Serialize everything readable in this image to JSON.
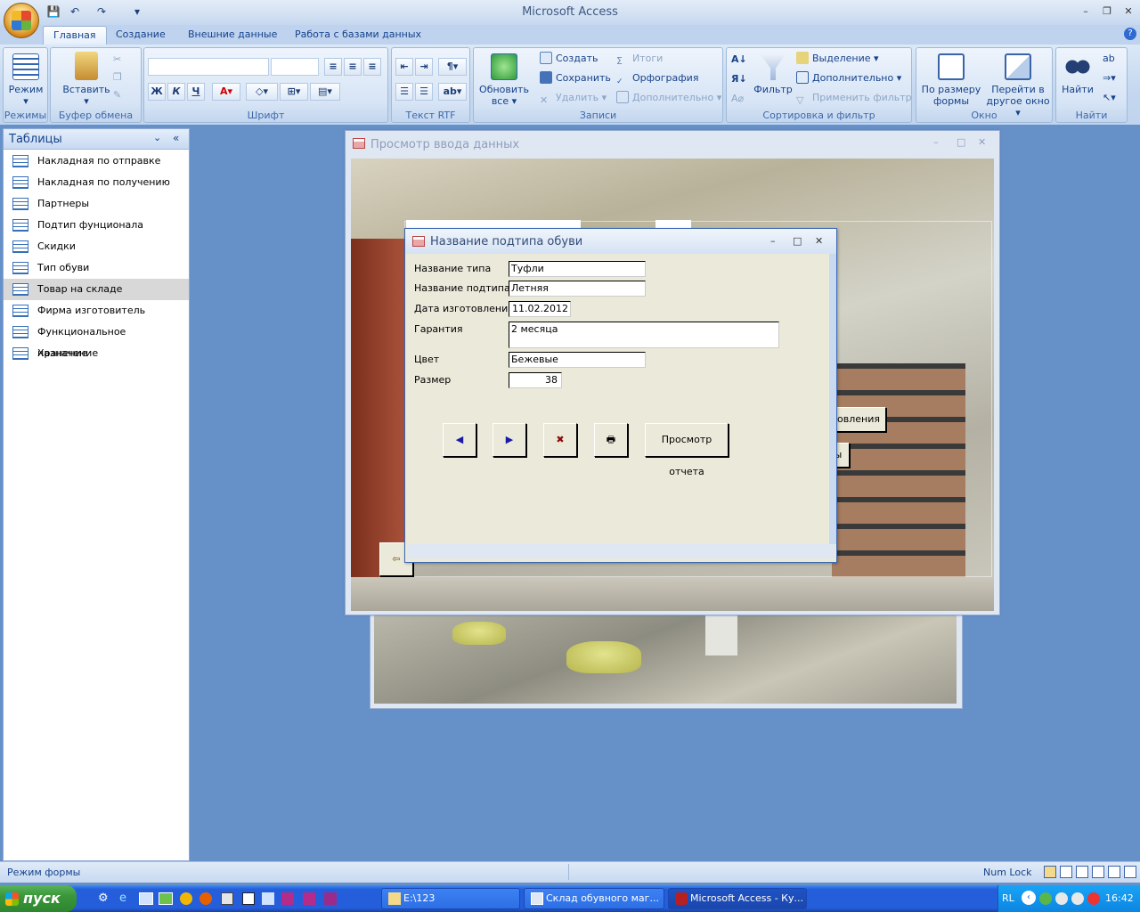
{
  "app": {
    "title": "Microsoft Access"
  },
  "tabs": [
    "Главная",
    "Создание",
    "Внешние данные",
    "Работа с базами данных"
  ],
  "ribbon": {
    "groups": [
      "Режимы",
      "Буфер обмена",
      "Шрифт",
      "Текст RTF",
      "Записи",
      "Сортировка и фильтр",
      "Окно",
      "Найти"
    ],
    "mode_btn": "Режим",
    "paste_btn": "Вставить",
    "refresh_btn": [
      "Обновить",
      "все"
    ],
    "records": {
      "create": "Создать",
      "save": "Сохранить",
      "delete": "Удалить",
      "totals": "Итоги",
      "spelling": "Орфография",
      "more": "Дополнительно"
    },
    "sort": {
      "filter": "Фильтр",
      "selection": "Выделение",
      "advanced": "Дополнительно",
      "apply": "Применить фильтр"
    },
    "window": {
      "fit": [
        "По размеру",
        "формы"
      ],
      "switch": [
        "Перейти в",
        "другое окно"
      ]
    },
    "find": "Найти",
    "font_buttons": [
      "Ж",
      "К",
      "Ч"
    ]
  },
  "nav": {
    "title": "Таблицы",
    "items": [
      "Накладная по отправке",
      "Накладная по получению",
      "Партнеры",
      "Подтип фунционала",
      "Скидки",
      "Тип обуви",
      "Товар на складе",
      "Фирма изготовитель",
      "Функциональное назначение",
      "Хранение"
    ],
    "selected_index": 6
  },
  "main_form": {
    "title": "Просмотр ввода данных",
    "partial_btn1": "товления",
    "partial_btn2": "ы"
  },
  "sub_form": {
    "title": "Название подтипа обуви",
    "fields": [
      {
        "label": "Название типа",
        "value": "Туфли"
      },
      {
        "label": "Название подтипа",
        "value": "Летняя"
      },
      {
        "label": "Дата изготовления",
        "value": "11.02.2012"
      },
      {
        "label": "Гарантия",
        "value": "2 месяца"
      },
      {
        "label": "Цвет",
        "value": "Бежевые"
      },
      {
        "label": "Размер",
        "value": "38"
      }
    ],
    "buttons": {
      "prev": "◀",
      "next": "▶",
      "delete": "✖",
      "print": "🖶",
      "report": "Просмотр отчета"
    }
  },
  "status": {
    "left": "Режим формы",
    "numlock": "Num Lock"
  },
  "taskbar": {
    "start": "пуск",
    "tasks": [
      "E:\\123",
      "Склад обувного маг...",
      "Microsoft Access - Ку..."
    ],
    "lang": "RL",
    "clock": "16:42"
  }
}
